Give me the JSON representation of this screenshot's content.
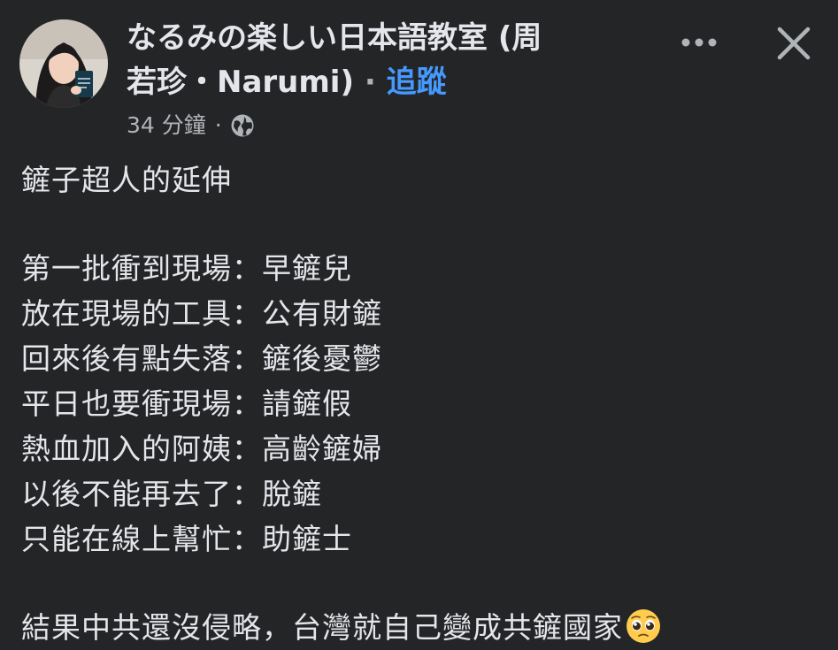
{
  "header": {
    "author_name_line1": "なるみの楽しい日本語教室 (周",
    "author_name_line2": "若珍・Narumi)",
    "separator": "·",
    "follow_label": "追蹤",
    "timestamp": "34 分鐘",
    "privacy_icon": "globe-icon",
    "more_icon": "more-options-icon",
    "close_icon": "close-icon"
  },
  "post": {
    "title": "鏟子超人的延伸",
    "lines": [
      "第一批衝到現場：早鏟兒",
      "放在現場的工具：公有財鏟",
      "回來後有點失落：鏟後憂鬱",
      "平日也要衝現場：請鏟假",
      "熱血加入的阿姨：高齡鏟婦",
      "以後不能再去了：脫鏟",
      "只能在線上幫忙：助鏟士"
    ],
    "closing": "結果中共還沒侵略，台灣就自己變成共鏟國家",
    "closing_emoji": "pleading-face-icon"
  },
  "colors": {
    "background": "#242526",
    "text_primary": "#e4e6eb",
    "text_secondary": "#b0b3b8",
    "link": "#4599ff"
  }
}
